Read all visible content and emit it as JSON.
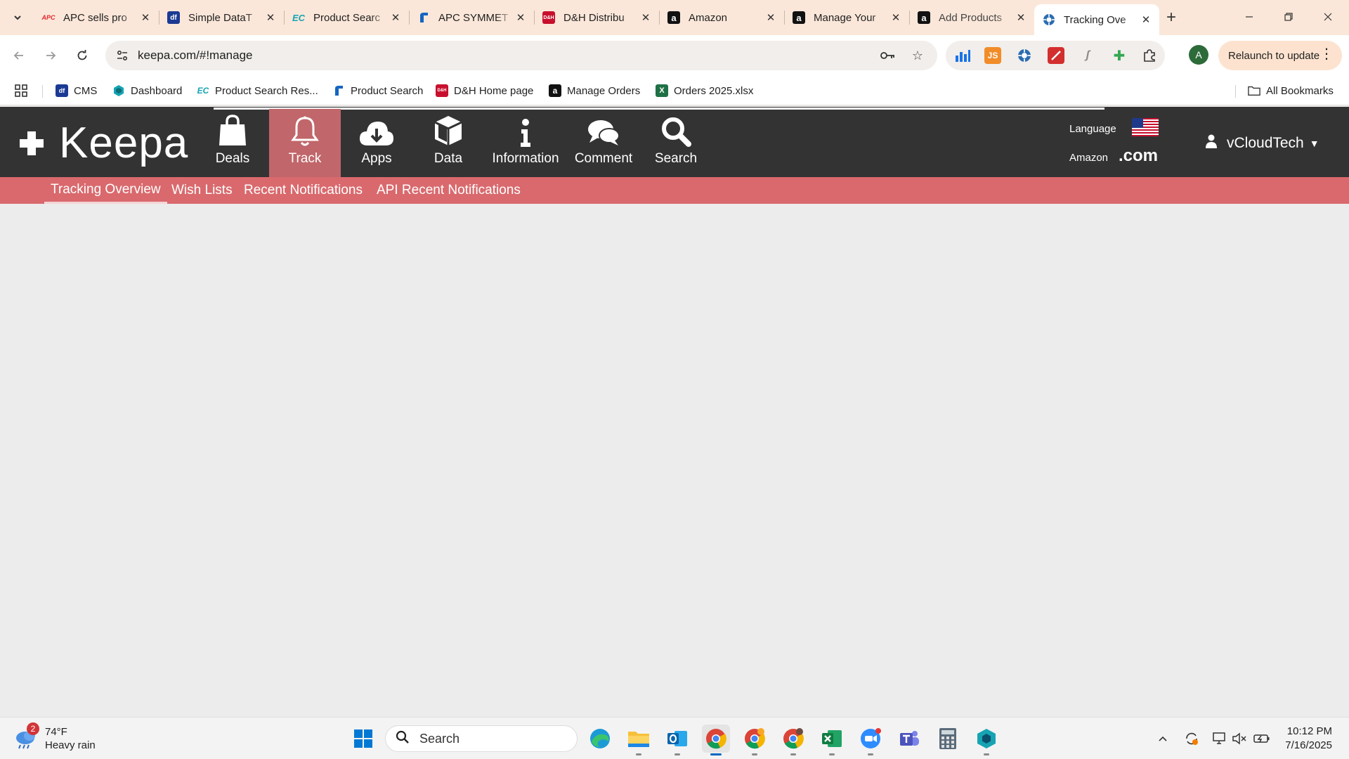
{
  "browser": {
    "tabs": [
      {
        "title": "APC sells pro",
        "favicon": "apc-logo",
        "color": "#e3262e"
      },
      {
        "title": "Simple DataT",
        "favicon": "df-logo",
        "color": "#1b3a93"
      },
      {
        "title": "Product Searc",
        "favicon": "ec-logo",
        "color": "#16a4b3"
      },
      {
        "title": "APC SYMMET",
        "favicon": "apc-blue-logo",
        "color": "#1565c0"
      },
      {
        "title": "D&H Distribu",
        "favicon": "dh-logo",
        "color": "#c8102e"
      },
      {
        "title": "Amazon",
        "favicon": "amazon-logo",
        "color": "#111111"
      },
      {
        "title": "Manage Your",
        "favicon": "amazon-logo",
        "color": "#111111"
      },
      {
        "title": "Add Products",
        "favicon": "amazon-logo",
        "color": "#111111"
      },
      {
        "title": "Tracking Ove",
        "favicon": "keepa-logo",
        "color": "#2b6cb0",
        "active": true
      }
    ],
    "url": "keepa.com/#!manage",
    "relaunch_label": "Relaunch to update",
    "profile_initial": "A",
    "bookmarks": [
      {
        "label": "CMS",
        "icon": "df-logo",
        "color": "#1b3a93"
      },
      {
        "label": "Dashboard",
        "icon": "dashboard-logo",
        "color": "#16a4b3"
      },
      {
        "label": "Product Search Res...",
        "icon": "ec-logo",
        "color": "#16a4b3"
      },
      {
        "label": "Product Search",
        "icon": "apc-blue-logo",
        "color": "#1565c0"
      },
      {
        "label": "D&H Home page",
        "icon": "dh-logo",
        "color": "#c8102e"
      },
      {
        "label": "Manage Orders",
        "icon": "amazon-logo",
        "color": "#111111"
      },
      {
        "label": "Orders 2025.xlsx",
        "icon": "excel-icon",
        "color": "#1e7145"
      }
    ],
    "all_bookmarks_label": "All Bookmarks"
  },
  "keepa": {
    "logo_text": "Keepa",
    "nav": [
      {
        "label": "Deals",
        "icon": "shopping-bag-icon"
      },
      {
        "label": "Track",
        "icon": "bell-icon",
        "active": true
      },
      {
        "label": "Apps",
        "icon": "cloud-download-icon"
      },
      {
        "label": "Data",
        "icon": "cube-icon"
      },
      {
        "label": "Information",
        "icon": "info-icon"
      },
      {
        "label": "Comment",
        "icon": "comments-icon"
      },
      {
        "label": "Search",
        "icon": "search-icon"
      }
    ],
    "language_label": "Language",
    "amazon_label": "Amazon",
    "domain": ".com",
    "username": "vCloudTech",
    "subnav": [
      {
        "label": "Tracking Overview",
        "active": true
      },
      {
        "label": "Wish Lists"
      },
      {
        "label": "Recent Notifications"
      },
      {
        "label": "API Recent Notifications"
      }
    ],
    "colors": {
      "header": "#333333",
      "accent": "#d9696d",
      "active_nav": "#c1666a"
    }
  },
  "taskbar": {
    "weather_temp": "74°F",
    "weather_condition": "Heavy rain",
    "weather_badge": "2",
    "search_placeholder": "Search",
    "time": "10:12 PM",
    "date": "7/16/2025"
  }
}
